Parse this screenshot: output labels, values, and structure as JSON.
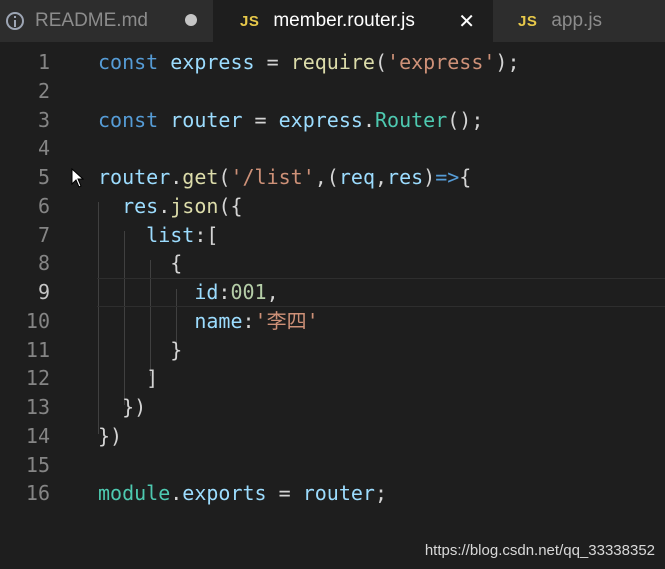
{
  "tabs": [
    {
      "icon": "info-icon",
      "label": "README.md",
      "state": "modified"
    },
    {
      "icon": "js-icon",
      "icon_text": "JS",
      "label": "member.router.js",
      "state": "active"
    },
    {
      "icon": "js-icon",
      "icon_text": "JS",
      "label": "app.js",
      "state": "inactive"
    }
  ],
  "editor": {
    "current_line": 9,
    "lines": [
      {
        "number": "1",
        "tokens": [
          [
            "kw",
            "const"
          ],
          [
            "p",
            " "
          ],
          [
            "var",
            "express"
          ],
          [
            "p",
            " = "
          ],
          [
            "fn",
            "require"
          ],
          [
            "p",
            "("
          ],
          [
            "str",
            "'express'"
          ],
          [
            "p",
            ");"
          ]
        ]
      },
      {
        "number": "2",
        "tokens": []
      },
      {
        "number": "3",
        "tokens": [
          [
            "kw",
            "const"
          ],
          [
            "p",
            " "
          ],
          [
            "var",
            "router"
          ],
          [
            "p",
            " = "
          ],
          [
            "var",
            "express"
          ],
          [
            "p",
            "."
          ],
          [
            "cls",
            "Router"
          ],
          [
            "p",
            "();"
          ]
        ]
      },
      {
        "number": "4",
        "tokens": []
      },
      {
        "number": "5",
        "tokens": [
          [
            "var",
            "router"
          ],
          [
            "p",
            "."
          ],
          [
            "fn",
            "get"
          ],
          [
            "p",
            "("
          ],
          [
            "str",
            "'/list'"
          ],
          [
            "p",
            ",("
          ],
          [
            "var",
            "req"
          ],
          [
            "p",
            ","
          ],
          [
            "var",
            "res"
          ],
          [
            "p",
            ")"
          ],
          [
            "kw",
            "=>"
          ],
          [
            "p",
            "{"
          ]
        ]
      },
      {
        "number": "6",
        "tokens": [
          [
            "p",
            "  "
          ],
          [
            "var",
            "res"
          ],
          [
            "p",
            "."
          ],
          [
            "fn",
            "json"
          ],
          [
            "p",
            "({"
          ]
        ]
      },
      {
        "number": "7",
        "tokens": [
          [
            "p",
            "    "
          ],
          [
            "var",
            "list"
          ],
          [
            "p",
            ":["
          ]
        ]
      },
      {
        "number": "8",
        "tokens": [
          [
            "p",
            "      {"
          ]
        ]
      },
      {
        "number": "9",
        "tokens": [
          [
            "p",
            "        "
          ],
          [
            "var",
            "id"
          ],
          [
            "p",
            ":"
          ],
          [
            "num",
            "001"
          ],
          [
            "p",
            ","
          ]
        ]
      },
      {
        "number": "10",
        "tokens": [
          [
            "p",
            "        "
          ],
          [
            "var",
            "name"
          ],
          [
            "p",
            ":"
          ],
          [
            "str",
            "'李四'"
          ]
        ]
      },
      {
        "number": "11",
        "tokens": [
          [
            "p",
            "      }"
          ]
        ]
      },
      {
        "number": "12",
        "tokens": [
          [
            "p",
            "    ]"
          ]
        ]
      },
      {
        "number": "13",
        "tokens": [
          [
            "p",
            "  })"
          ]
        ]
      },
      {
        "number": "14",
        "tokens": [
          [
            "p",
            "})"
          ]
        ]
      },
      {
        "number": "15",
        "tokens": []
      },
      {
        "number": "16",
        "tokens": [
          [
            "cls",
            "module"
          ],
          [
            "p",
            "."
          ],
          [
            "var",
            "exports"
          ],
          [
            "p",
            " = "
          ],
          [
            "var",
            "router"
          ],
          [
            "p",
            ";"
          ]
        ]
      }
    ]
  },
  "watermark": "https://blog.csdn.net/qq_33338352",
  "colors": {
    "keyword": "#569cd6",
    "variable": "#9cdcfe",
    "function": "#dcdcaa",
    "class": "#4ec9b0",
    "string": "#ce9178",
    "number": "#b5cea8",
    "punctuation": "#d4d4d4",
    "js_badge": "#e8c94a"
  }
}
